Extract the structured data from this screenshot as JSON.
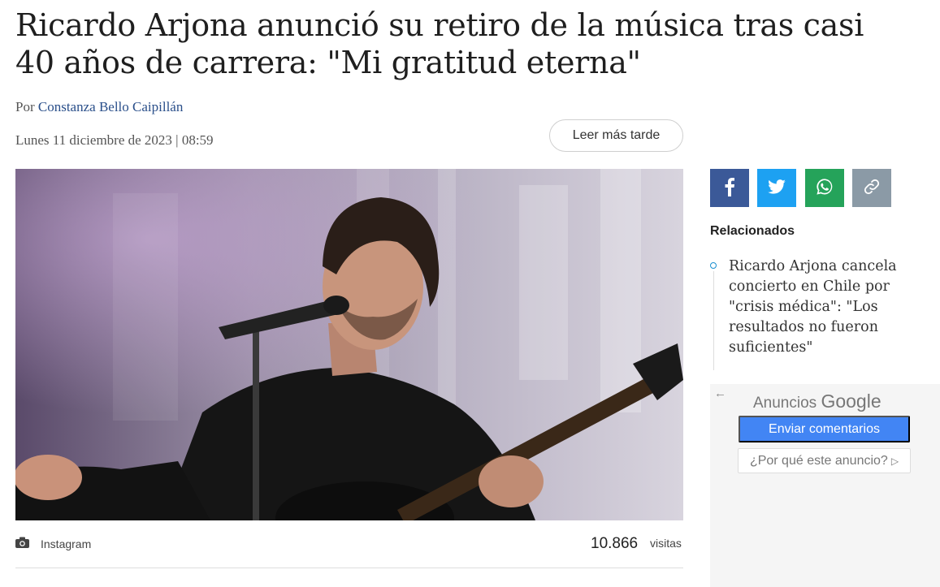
{
  "article": {
    "title": "Ricardo Arjona anunció su retiro de la música tras casi 40 años de carrera: \"Mi gratitud eterna\"",
    "byline_prefix": "Por",
    "author": "Constanza Bello Caipillán",
    "date": "Lunes 11 diciembre de 2023 | 08:59",
    "read_later_label": "Leer más tarde",
    "image_caption": "Instagram",
    "visits_count": "10.866",
    "visits_label": "visitas"
  },
  "share": {
    "icons": [
      "facebook-icon",
      "twitter-icon",
      "whatsapp-icon",
      "link-icon"
    ],
    "colors": {
      "facebook": "#3b5998",
      "twitter": "#1da1f2",
      "whatsapp": "#25a35a",
      "link": "#8b9aa6"
    }
  },
  "related": {
    "title": "Relacionados",
    "items": [
      {
        "text": "Ricardo Arjona cancela concierto en Chile por \"crisis médica\": \"Los resultados no fueron suficientes\""
      }
    ]
  },
  "ad": {
    "header_prefix": "Anuncios",
    "header_brand": "Google",
    "send_feedback": "Enviar comentarios",
    "why_this_ad": "¿Por qué este anuncio?"
  }
}
